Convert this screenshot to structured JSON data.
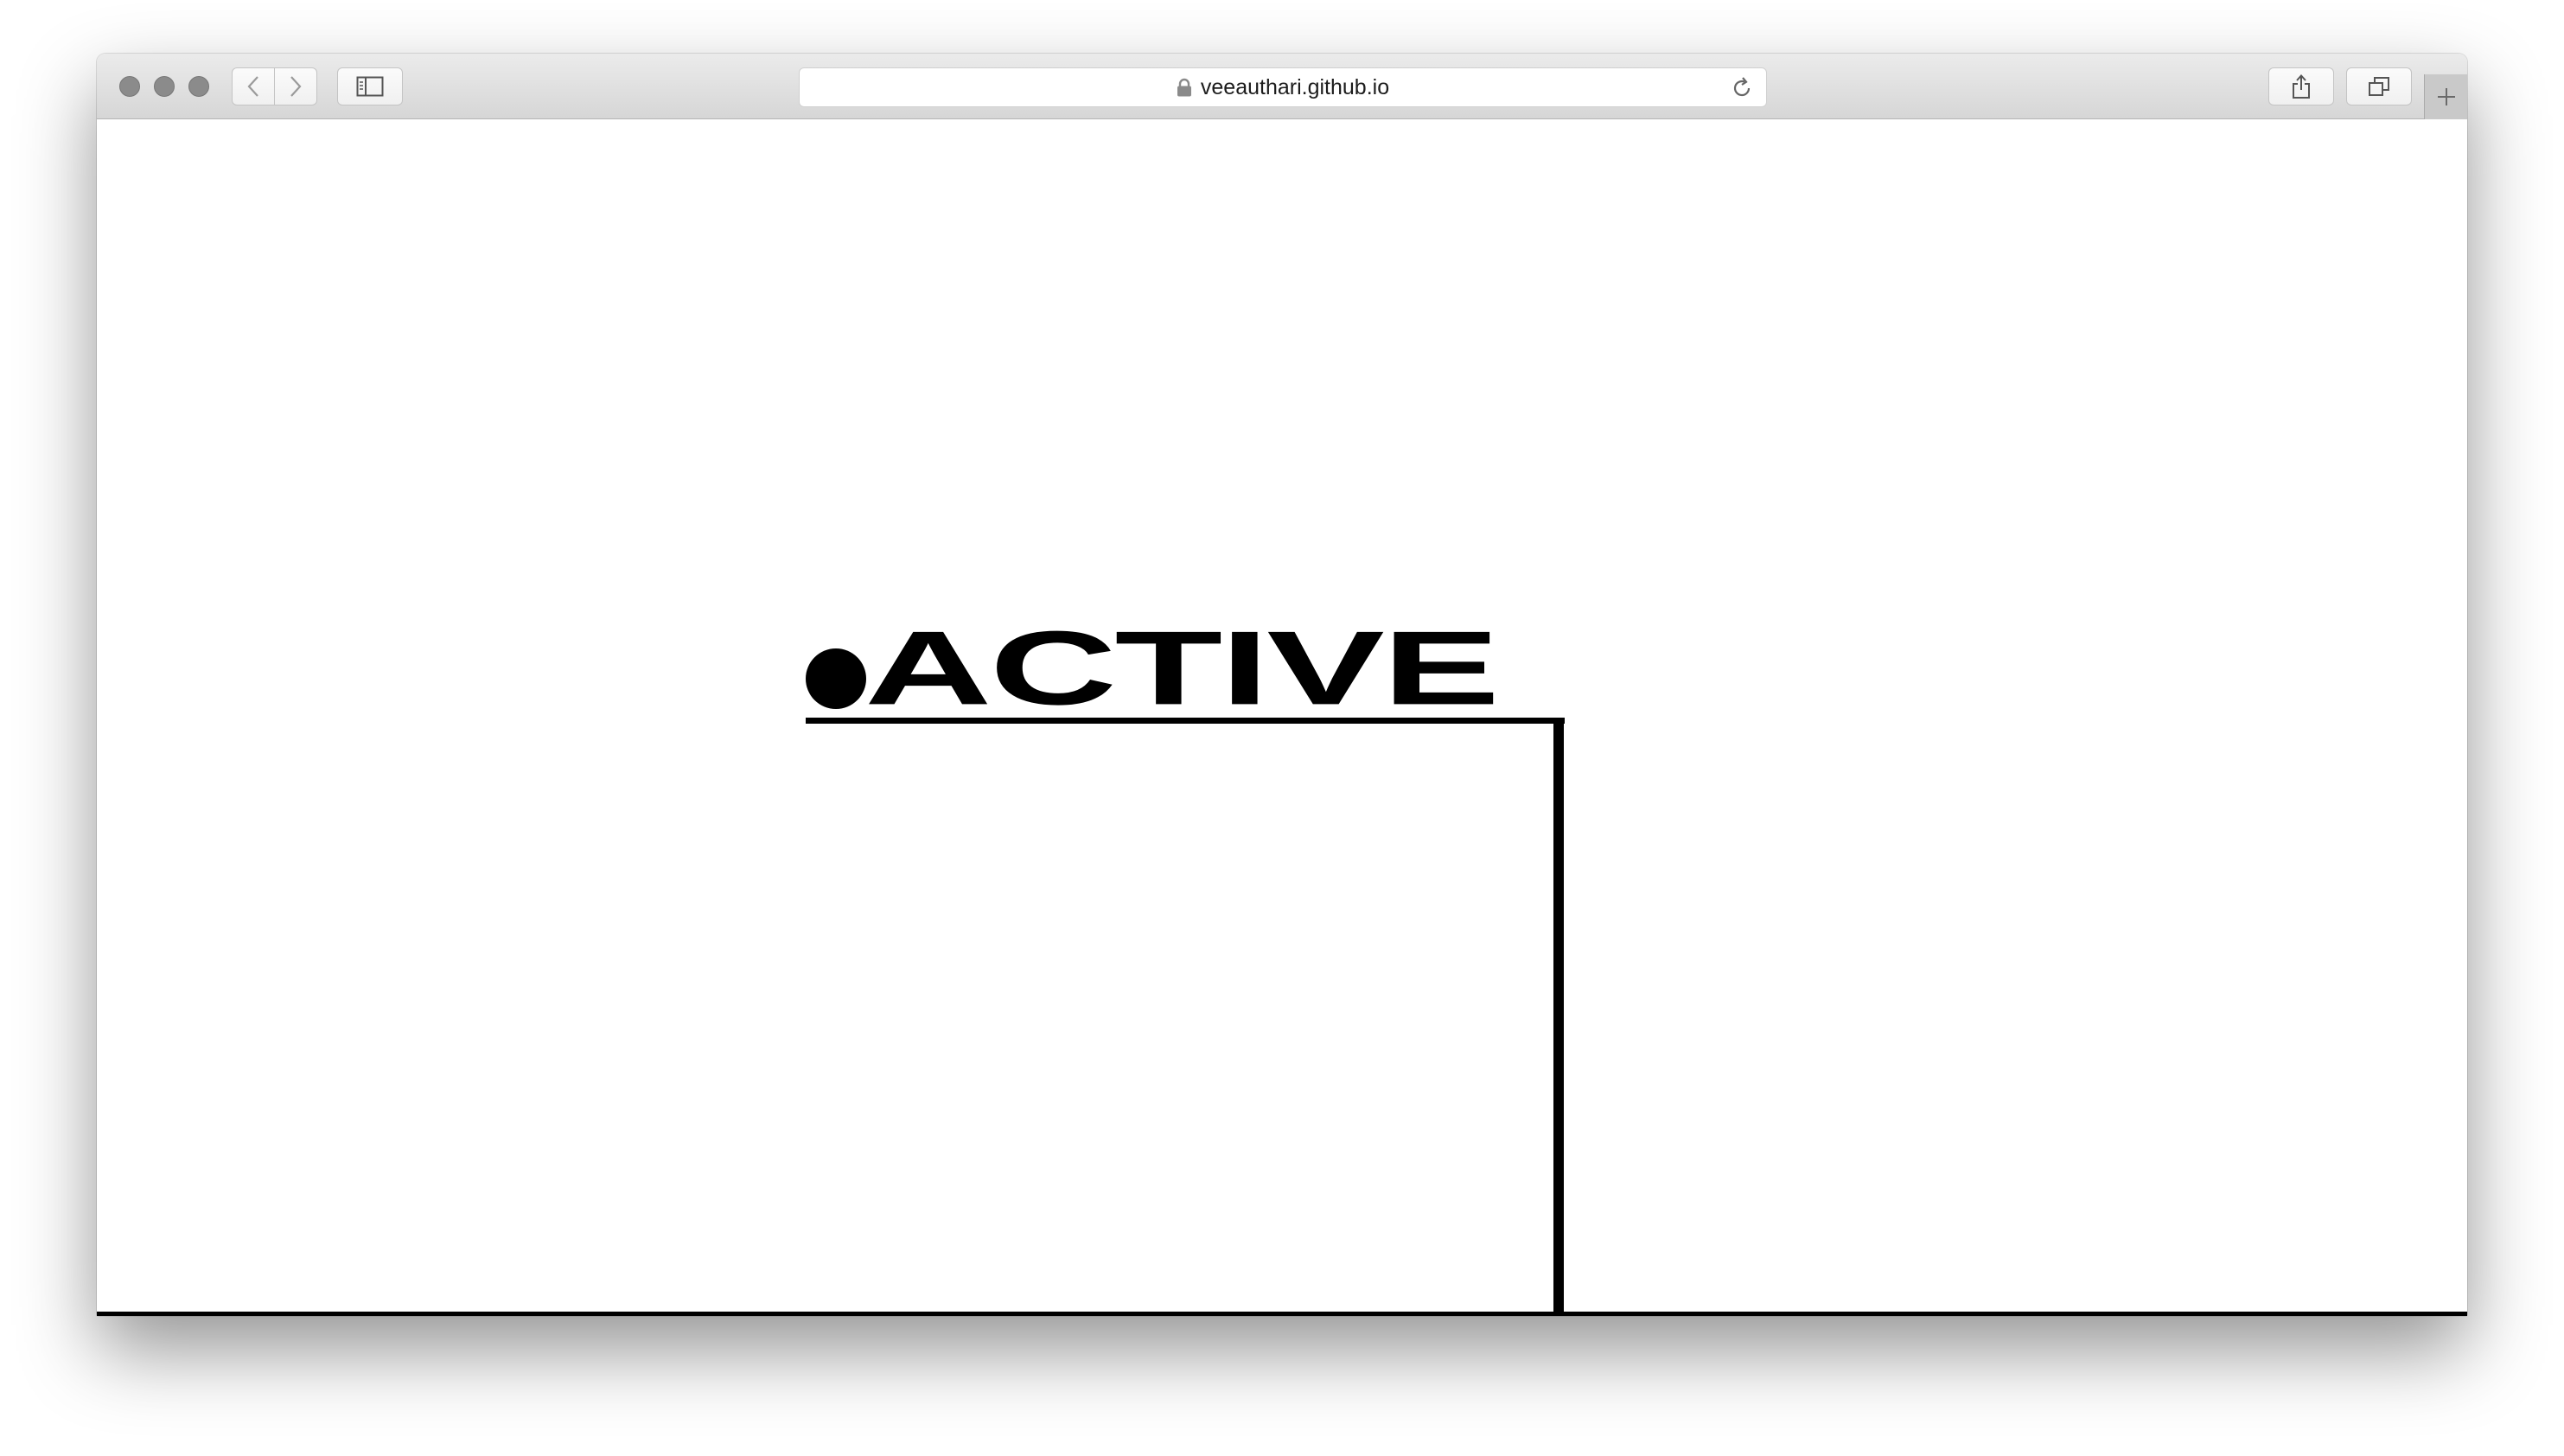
{
  "browser": {
    "url": "veeauthari.github.io",
    "secure": true
  },
  "page": {
    "logo_text": "ACTIVE"
  }
}
